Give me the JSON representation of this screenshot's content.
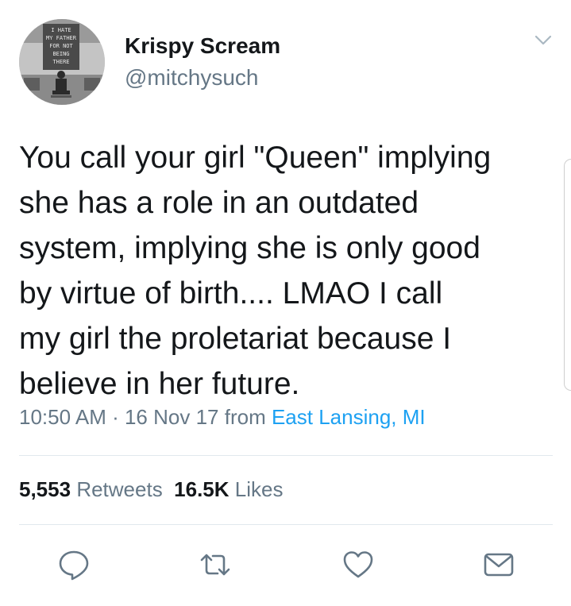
{
  "user": {
    "display_name": "Krispy Scream",
    "handle": "@mitchysuch",
    "avatar_sign_lines": [
      "I HATE",
      "MY FATHER",
      "FOR NOT",
      "BEING",
      "THERE"
    ]
  },
  "tweet": {
    "lines": [
      "You call your girl \"Queen\" implying",
      "she has a role in an outdated",
      "system, implying she is only good",
      "by virtue of birth.... LMAO I call",
      "my girl the proletariat because I",
      "believe in her future."
    ]
  },
  "meta": {
    "time": "10:50 AM",
    "separator": " · ",
    "date": "16 Nov 17",
    "from_label": " from ",
    "location": "East Lansing, MI"
  },
  "stats": {
    "retweets_count": "5,553",
    "retweets_label": "Retweets",
    "likes_count": "16.5K",
    "likes_label": "Likes"
  },
  "actions": {
    "reply_icon": "reply-icon",
    "retweet_icon": "retweet-icon",
    "like_icon": "heart-icon",
    "dm_icon": "envelope-icon"
  },
  "colors": {
    "text": "#14171a",
    "secondary": "#657786",
    "link": "#1da1f2",
    "divider": "#e1e8ed",
    "icon": "#657786"
  }
}
